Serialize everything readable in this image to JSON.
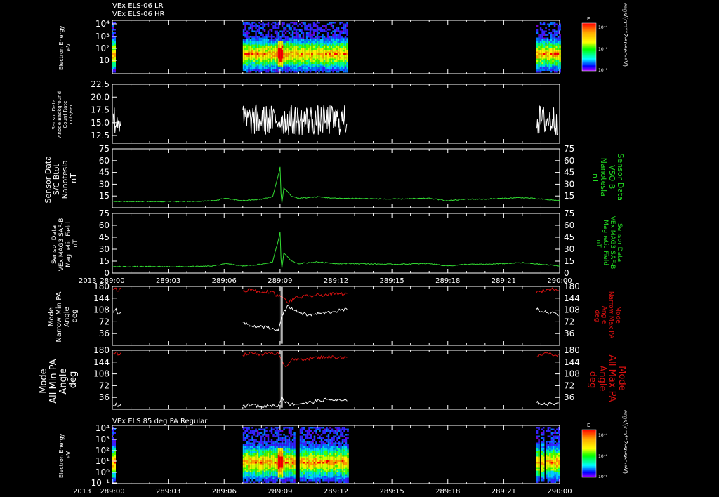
{
  "header": {
    "line1": "VEx ELS-06 LR",
    "line2": "VEx ELS-06 HR"
  },
  "time_axis": {
    "year": "2013",
    "ticks": [
      "289:00",
      "289:03",
      "289:06",
      "289:09",
      "289:12",
      "289:15",
      "289:18",
      "289:21",
      "290:00"
    ],
    "minor_per_major": 3
  },
  "chart_data": [
    {
      "type": "heatmap",
      "id": "els_energy_top",
      "ylabel": "Electron Energy\neV",
      "yticks": [
        "10⁴",
        "10³",
        "10²",
        "10"
      ],
      "colorbar": {
        "title": "El",
        "ticks": [
          "10⁻⁴",
          "10⁻⁶",
          "10⁻⁸"
        ]
      },
      "unit_label": "ergs/(cm**2-sr-sec-eV)",
      "coverage_hours": [
        [
          0.0,
          0.17
        ],
        [
          7.0,
          12.6
        ],
        [
          22.75,
          24.0
        ]
      ]
    },
    {
      "type": "line",
      "id": "anode_background",
      "ylabel": "Sensor Data\nAnode Background\nCount Rate\ncnts/sec",
      "ylim": [
        11,
        22.5
      ],
      "yticks": [
        "22.5",
        "20.0",
        "17.5",
        "15.0",
        "12.5"
      ],
      "color": "#ffffff",
      "segments": [
        [
          0.05,
          0.45
        ],
        [
          7.0,
          12.6
        ],
        [
          22.75,
          23.95
        ]
      ],
      "mean": 15.5,
      "noise": 3
    },
    {
      "type": "line",
      "id": "sc_btot",
      "ylabel": "Sensor Data\nS/C Btot\nNanotesla\nnT",
      "right_label": "Sensor Data\nVSO B\nNanotesla\nnT",
      "ylim": [
        0,
        75
      ],
      "yticks": [
        "75",
        "60",
        "45",
        "30",
        "15"
      ],
      "color": "#33dd33",
      "x": [
        0,
        2,
        4,
        5,
        5.5,
        6,
        7,
        7.5,
        8,
        8.6,
        8.95,
        9.0,
        9.05,
        9.1,
        9.2,
        9.35,
        9.6,
        10,
        11,
        12,
        13,
        15,
        17,
        18,
        19,
        20,
        21,
        22,
        23,
        24
      ],
      "y": [
        8,
        8,
        8,
        8.5,
        9,
        12,
        9,
        10,
        11,
        14,
        45,
        52,
        18,
        6,
        25,
        22,
        15,
        12,
        14,
        12,
        12,
        11,
        12,
        9,
        11,
        11,
        12,
        13,
        11,
        9
      ]
    },
    {
      "type": "line",
      "id": "mag_saf_b",
      "ylabel": "Sensor Data\nVEx MAG3 SAF-B\nMagnetic Field\nnT",
      "right_label": "Sensor Data\nVEx MAG3 SAF-B\nMagnetic Field\nnT",
      "ylim": [
        0,
        75
      ],
      "yticks": [
        "75",
        "60",
        "45",
        "30",
        "15",
        "0"
      ],
      "color": "#33dd33",
      "x": [
        0,
        2,
        4,
        5,
        5.5,
        6,
        7,
        7.5,
        8,
        8.6,
        8.95,
        9.0,
        9.05,
        9.1,
        9.2,
        9.35,
        9.6,
        10,
        11,
        12,
        13,
        15,
        17,
        18,
        19,
        20,
        21,
        22,
        23,
        24
      ],
      "y": [
        8,
        8,
        8,
        8.5,
        9,
        12,
        9,
        10,
        11,
        14,
        45,
        52,
        18,
        6,
        25,
        22,
        15,
        12,
        14,
        12,
        12,
        11,
        12,
        9,
        11,
        11,
        12,
        13,
        11,
        9
      ]
    },
    {
      "type": "line",
      "id": "narrow_pa",
      "ylabel": "Mode\nNarrow Min PA\nAngle\ndeg",
      "right_label": "Mode\nNarrow Max PA\nAngle\ndeg",
      "ylim": [
        0,
        180
      ],
      "yticks": [
        "180",
        "144",
        "108",
        "72",
        "36"
      ],
      "series": [
        {
          "color": "#ffffff",
          "x": [
            0.05,
            0.2,
            0.3,
            0.45,
            7.0,
            7.5,
            8.0,
            8.5,
            8.9,
            9.1,
            9.4,
            9.8,
            10.5,
            11.5,
            12.6,
            22.75,
            23.3,
            23.8,
            23.95
          ],
          "y": [
            100,
            112,
            95,
            100,
            70,
            58,
            60,
            50,
            45,
            90,
            122,
            106,
            92,
            100,
            110,
            110,
            100,
            98,
            90
          ]
        },
        {
          "color": "#dd1111",
          "x": [
            0.05,
            0.2,
            0.3,
            0.45,
            7.0,
            7.5,
            8.0,
            8.5,
            8.9,
            9.1,
            9.4,
            9.8,
            10.5,
            11.5,
            12.6,
            22.75,
            23.3,
            23.8,
            23.95
          ],
          "y": [
            170,
            175,
            165,
            175,
            165,
            172,
            160,
            165,
            150,
            150,
            130,
            145,
            150,
            155,
            158,
            160,
            170,
            172,
            168
          ]
        }
      ]
    },
    {
      "type": "line",
      "id": "all_pa",
      "ylabel": "Mode\nAll Min PA\nAngle\ndeg",
      "right_label": "Mode\nAll Max PA\nAngle\ndeg",
      "ylim": [
        0,
        180
      ],
      "yticks": [
        "180",
        "144",
        "108",
        "72",
        "36"
      ],
      "series": [
        {
          "color": "#ffffff",
          "x": [
            0.05,
            0.2,
            0.3,
            0.45,
            7.0,
            7.5,
            8.0,
            8.5,
            8.9,
            9.1,
            9.3,
            9.6,
            10.5,
            11.5,
            12.6,
            22.75,
            23.3,
            23.8,
            23.95
          ],
          "y": [
            12,
            18,
            8,
            15,
            10,
            14,
            8,
            12,
            10,
            40,
            20,
            15,
            20,
            30,
            25,
            20,
            15,
            18,
            20
          ]
        },
        {
          "color": "#dd1111",
          "x": [
            0.05,
            0.2,
            0.3,
            0.45,
            7.0,
            7.5,
            8.0,
            8.5,
            8.9,
            9.1,
            9.3,
            9.6,
            10.5,
            11.5,
            12.6,
            22.75,
            23.3,
            23.8,
            23.95
          ],
          "y": [
            170,
            175,
            165,
            172,
            165,
            172,
            168,
            170,
            172,
            150,
            130,
            150,
            155,
            160,
            158,
            160,
            172,
            165,
            168
          ]
        }
      ]
    },
    {
      "type": "heatmap",
      "id": "els_85deg",
      "title": "VEx ELS 85 deg PA Regular",
      "ylabel": "Electron Energy\neV",
      "yticks": [
        "10⁴",
        "10³",
        "10²",
        "10¹",
        "10⁰",
        "10⁻¹"
      ],
      "colorbar": {
        "title": "El",
        "ticks": [
          "10⁻⁴",
          "10⁻⁶",
          "10⁻⁸"
        ]
      },
      "unit_label": "ergs/(cm**2-sr-sec-eV)",
      "coverage_hours": [
        [
          0.0,
          0.17
        ],
        [
          7.0,
          9.8
        ],
        [
          10.05,
          12.6
        ],
        [
          22.75,
          22.9
        ],
        [
          23.0,
          23.15
        ],
        [
          23.25,
          24.0
        ]
      ]
    }
  ]
}
